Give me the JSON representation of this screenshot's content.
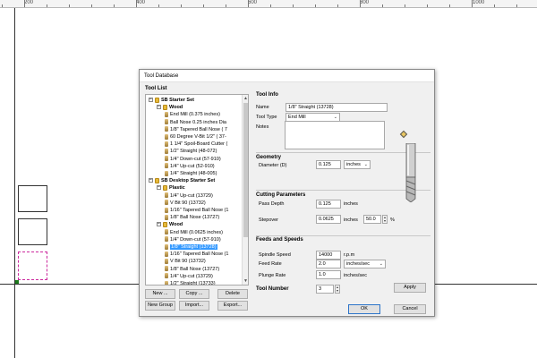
{
  "ruler": {
    "labels": [
      "200",
      "400",
      "600",
      "800",
      "1000"
    ]
  },
  "dialog": {
    "title": "Tool Database",
    "tool_list_label": "Tool List",
    "tool_info_label": "Tool Info",
    "tree": [
      {
        "label": "SB Starter Set",
        "type": "group",
        "level": 0,
        "expander": "−"
      },
      {
        "label": "Wood",
        "type": "group",
        "level": 1,
        "expander": "−"
      },
      {
        "label": "End Mill (0.375 inches)",
        "type": "tool",
        "level": 2
      },
      {
        "label": "Ball Nose 0.25 inches Dia",
        "type": "tool",
        "level": 2
      },
      {
        "label": "1/8\" Tapered Ball Nose ( 7",
        "type": "tool",
        "level": 2
      },
      {
        "label": "60 Degree V-Bit 1/2\" ( 37-",
        "type": "tool",
        "level": 2
      },
      {
        "label": "1 1/4\" Spoil-Board Cutter (",
        "type": "tool",
        "level": 2
      },
      {
        "label": "1/2\" Straight  (48-072)",
        "type": "tool",
        "level": 2
      },
      {
        "label": "1/4\" Down-cut (57-910)",
        "type": "tool",
        "level": 2
      },
      {
        "label": "1/4\" Up-cut (52-910)",
        "type": "tool",
        "level": 2
      },
      {
        "label": "1/4\" Straight  (48-005)",
        "type": "tool",
        "level": 2
      },
      {
        "label": "SB Desktop Starter Set",
        "type": "group",
        "level": 0,
        "expander": "−"
      },
      {
        "label": "Plastic",
        "type": "group",
        "level": 1,
        "expander": "−"
      },
      {
        "label": "1/4\" Up-cut (13729)",
        "type": "tool",
        "level": 2
      },
      {
        "label": "V Bit 90 (13732)",
        "type": "tool",
        "level": 2
      },
      {
        "label": "1/16\" Tapered Ball Nose (1",
        "type": "tool",
        "level": 2
      },
      {
        "label": "1/8\" Ball Nose (13727)",
        "type": "tool",
        "level": 2
      },
      {
        "label": "Wood",
        "type": "group",
        "level": 1,
        "expander": "−"
      },
      {
        "label": "End Mill (0.0625 inches)",
        "type": "tool",
        "level": 2
      },
      {
        "label": "1/4\" Down-cut (57-910)",
        "type": "tool",
        "level": 2
      },
      {
        "label": "1/8\" Straight (13728)",
        "type": "tool",
        "level": 2,
        "selected": true
      },
      {
        "label": "1/16\" Tapered Ball Nose (1",
        "type": "tool",
        "level": 2
      },
      {
        "label": "V Bit 90 (13732)",
        "type": "tool",
        "level": 2
      },
      {
        "label": "1/8\" Ball Nose (13727)",
        "type": "tool",
        "level": 2
      },
      {
        "label": "1/4\" Up-cut (13729)",
        "type": "tool",
        "level": 2
      },
      {
        "label": "1/2\" Straight (13733)",
        "type": "tool",
        "level": 2
      }
    ],
    "buttons": {
      "new": "New ...",
      "copy": "Copy ...",
      "delete": "Delete",
      "new_group": "New Group",
      "import": "Import...",
      "export": "Export...",
      "apply": "Apply",
      "ok": "OK",
      "cancel": "Cancel"
    },
    "form": {
      "name_label": "Name",
      "name_value": "1/8\" Straight (13728)",
      "tool_type_label": "Tool Type",
      "tool_type_value": "End Mill",
      "notes_label": "Notes",
      "geometry_label": "Geometry",
      "diameter_label": "Diameter (D)",
      "diameter_value": "0.125",
      "diameter_unit": "inches",
      "cutting_label": "Cutting Parameters",
      "pass_depth_label": "Pass Depth",
      "pass_depth_value": "0.125",
      "pass_depth_unit": "inches",
      "stepover_label": "Stepover",
      "stepover_value": "0.0625",
      "stepover_unit": "inches",
      "stepover_percent": "50.0",
      "percent_sign": "%",
      "feeds_label": "Feeds and Speeds",
      "spindle_label": "Spindle Speed",
      "spindle_value": "14000",
      "spindle_unit": "r.p.m",
      "feed_rate_label": "Feed Rate",
      "feed_rate_value": "2.0",
      "feed_rate_unit": "inches/sec",
      "plunge_label": "Plunge Rate",
      "plunge_value": "1.0",
      "plunge_unit": "inches/sec",
      "tool_number_label": "Tool Number",
      "tool_number_value": "3"
    }
  }
}
